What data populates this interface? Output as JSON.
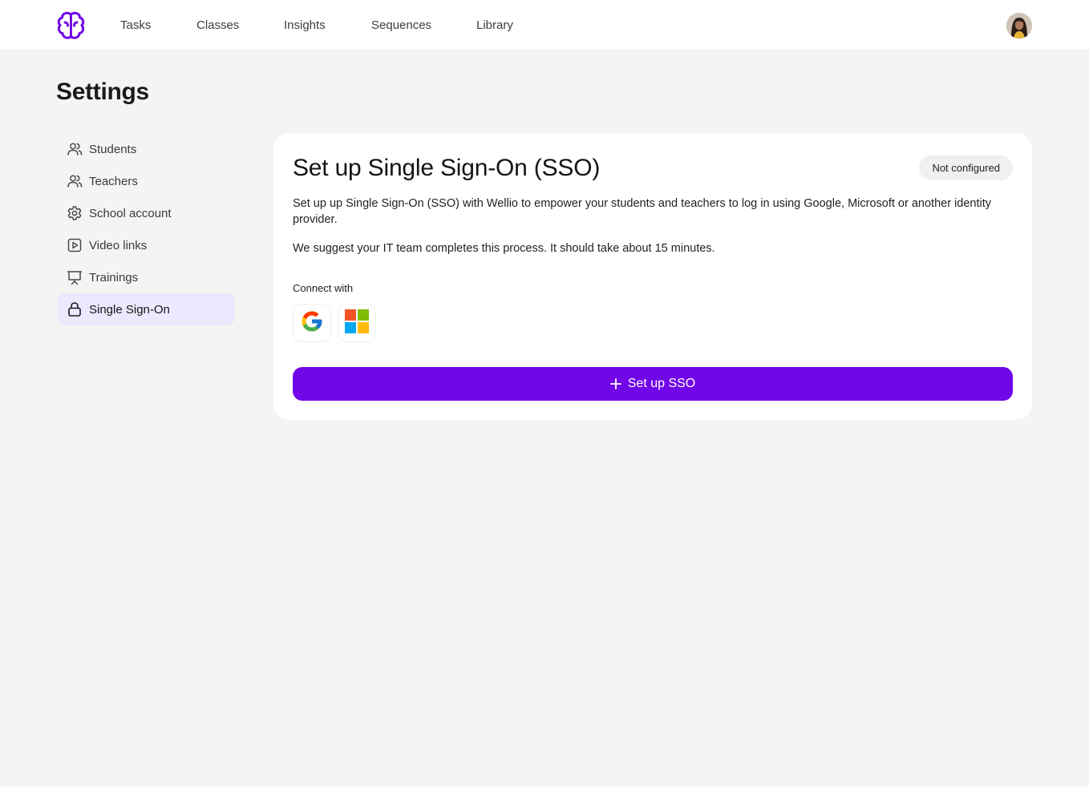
{
  "nav": {
    "items": [
      {
        "label": "Tasks"
      },
      {
        "label": "Classes"
      },
      {
        "label": "Insights"
      },
      {
        "label": "Sequences"
      },
      {
        "label": "Library"
      }
    ]
  },
  "page": {
    "title": "Settings"
  },
  "sidebar": {
    "items": [
      {
        "label": "Students",
        "icon": "users-icon"
      },
      {
        "label": "Teachers",
        "icon": "users-icon"
      },
      {
        "label": "School account",
        "icon": "gear-icon"
      },
      {
        "label": "Video links",
        "icon": "play-icon"
      },
      {
        "label": "Trainings",
        "icon": "presentation-icon"
      },
      {
        "label": "Single Sign-On",
        "icon": "lock-icon",
        "active": true
      }
    ]
  },
  "sso": {
    "title": "Set up Single Sign-On (SSO)",
    "status": "Not configured",
    "description": "Set up up Single Sign-On (SSO) with Wellio to empower your students and teachers to log in using Google, Microsoft or another identity provider.",
    "note": "We suggest your IT team completes this process. It should take about 15 minutes.",
    "connect_label": "Connect with",
    "providers": [
      "Google",
      "Microsoft"
    ],
    "button_label": "Set up SSO"
  },
  "colors": {
    "accent": "#7106e8",
    "active_bg": "#ece8fd",
    "page_bg": "#f4f4f3"
  }
}
